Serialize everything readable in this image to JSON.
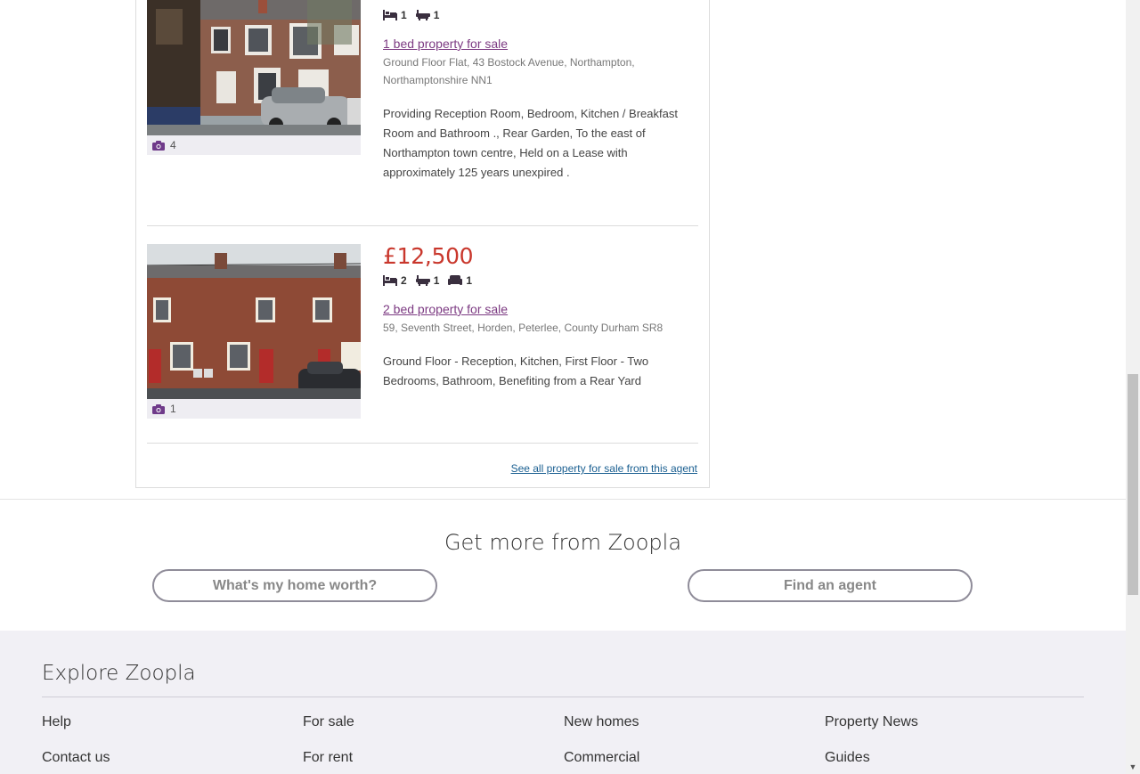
{
  "listings": [
    {
      "price": "",
      "beds": "1",
      "baths": "1",
      "receptions": "",
      "title": "1 bed property for sale",
      "address": "Ground Floor Flat, 43 Bostock Avenue, Northampton, Northamptonshire NN1",
      "description": "Providing Reception Room, Bedroom, Kitchen / Breakfast Room and Bathroom ., Rear Garden, To the east of Northampton town centre, Held on a Lease with approximately 125 years unexpired .",
      "photo_count": "4"
    },
    {
      "price": "£12,500",
      "beds": "2",
      "baths": "1",
      "receptions": "1",
      "title": "2 bed property for sale",
      "address": "59, Seventh Street, Horden, Peterlee, County Durham SR8",
      "description": "Ground Floor - Reception, Kitchen, First Floor - Two Bedrooms, Bathroom, Benefiting from a Rear Yard",
      "photo_count": "1"
    }
  ],
  "see_all_link": "See all property for sale from this agent",
  "more": {
    "title": "Get more from Zoopla",
    "home_worth_button": "What's my home worth?",
    "find_agent_button": "Find an agent"
  },
  "footer": {
    "title": "Explore Zoopla",
    "links": [
      "Help",
      "Contact us",
      "For sale",
      "For rent",
      "New homes",
      "Commercial",
      "Property News",
      "Guides"
    ]
  },
  "colors": {
    "price": "#c9372c",
    "link_purple": "#7c3a82",
    "agent_link": "#1a5f91",
    "footer_bg": "#f1f0f5"
  }
}
